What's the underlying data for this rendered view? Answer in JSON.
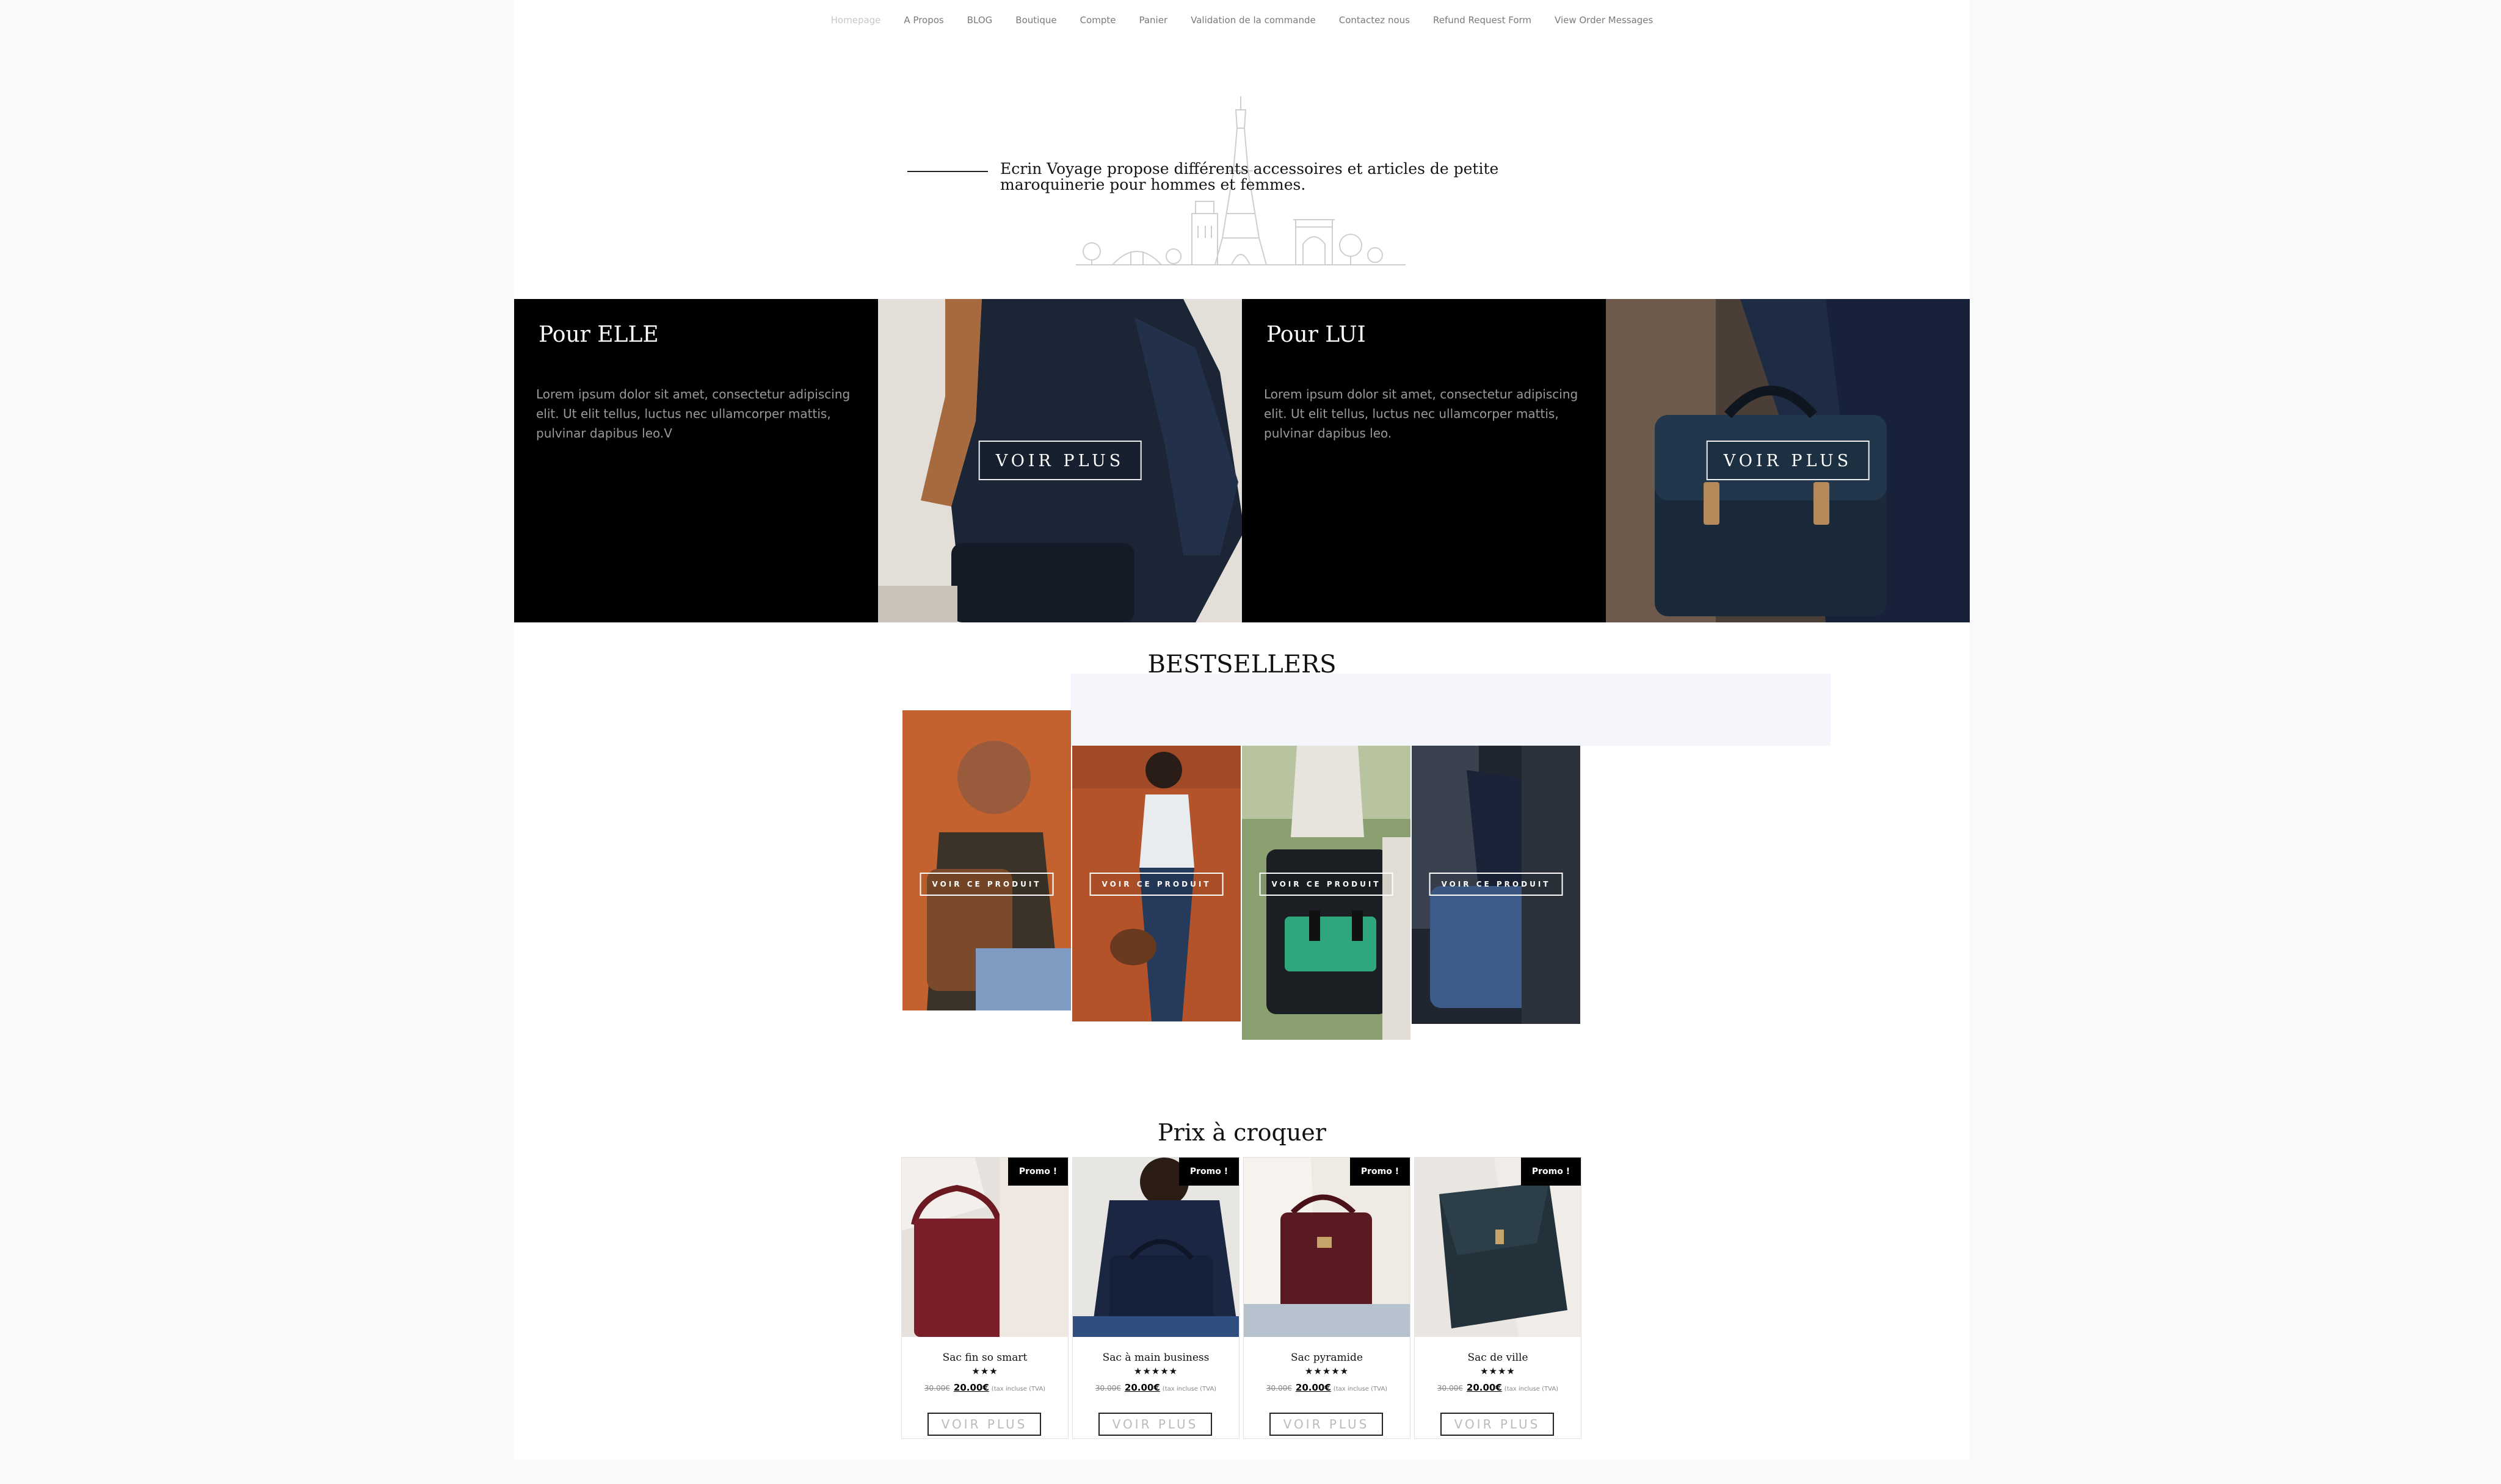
{
  "nav": {
    "items": [
      "Homepage",
      "A Propos",
      "BLOG",
      "Boutique",
      "Compte",
      "Panier",
      "Validation de la commande",
      "Contactez nous",
      "Refund Request Form",
      "View Order Messages"
    ]
  },
  "intro": {
    "text": "Ecrin Voyage propose différents accessoires et articles de petite maroquinerie pour hommes et femmes."
  },
  "banner": {
    "elle": {
      "title": "Pour ELLE",
      "text": "Lorem ipsum dolor sit amet, consectetur adipiscing elit. Ut elit tellus, luctus nec ullamcorper mattis, pulvinar dapibus leo.V",
      "button": "VOIR PLUS"
    },
    "lui": {
      "title": "Pour LUI",
      "text": "Lorem ipsum dolor sit amet, consectetur adipiscing elit. Ut elit tellus, luctus nec ullamcorper mattis, pulvinar dapibus leo.",
      "button": "VOIR PLUS"
    }
  },
  "bestsellers": {
    "title": "BESTSELLERS",
    "button": "VOIR CE PRODUIT"
  },
  "promo": {
    "title": "Prix à croquer",
    "badge": "Promo !",
    "button": "VOIR PLUS",
    "products": [
      {
        "name": "Sac fin so smart",
        "stars": "★★★",
        "rating": 3,
        "old_price": "30.00€",
        "price": "20.00€",
        "tax": "(tax incluse (TVA)"
      },
      {
        "name": "Sac à main business",
        "stars": "★★★★★",
        "rating": 5,
        "old_price": "30.00€",
        "price": "20.00€",
        "tax": "(tax incluse (TVA)"
      },
      {
        "name": "Sac pyramide",
        "stars": "★★★★★",
        "rating": 5,
        "old_price": "30.00€",
        "price": "20.00€",
        "tax": "(tax incluse (TVA)"
      },
      {
        "name": "Sac de ville",
        "stars": "★★★★",
        "rating": 4,
        "old_price": "30.00€",
        "price": "20.00€",
        "tax": "(tax incluse (TVA)"
      }
    ]
  }
}
